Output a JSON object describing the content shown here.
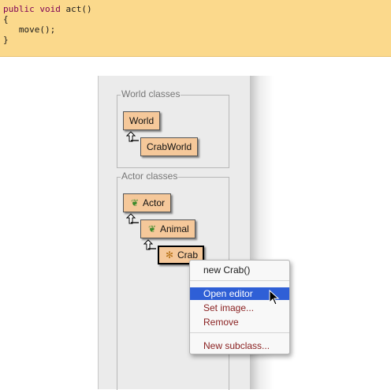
{
  "code": {
    "lines": [
      {
        "kw1": "public",
        "kw2": "void",
        "rest": " act()"
      },
      {
        "text": "{"
      },
      {
        "text": "   move();"
      },
      {
        "text": "}"
      }
    ]
  },
  "world_group": {
    "title": "World classes",
    "classes": [
      {
        "name": "World"
      },
      {
        "name": "CrabWorld"
      }
    ]
  },
  "actor_group": {
    "title": "Actor classes",
    "classes": [
      {
        "name": "Actor",
        "icon": "footprint-icon"
      },
      {
        "name": "Animal",
        "icon": "footprint-icon"
      },
      {
        "name": "Crab",
        "icon": "crab-icon",
        "selected": true
      }
    ]
  },
  "context_menu": {
    "items": [
      {
        "label": "new Crab()"
      },
      {
        "label": "Open editor",
        "highlighted": true
      },
      {
        "label": "Set image..."
      },
      {
        "label": "Remove"
      },
      {
        "label": "New subclass..."
      }
    ]
  },
  "colors": {
    "code_bg": "#fbd98c",
    "class_box": "#f5c89a",
    "menu_highlight": "#2f5fd6",
    "menu_red_text": "#8a2121"
  }
}
